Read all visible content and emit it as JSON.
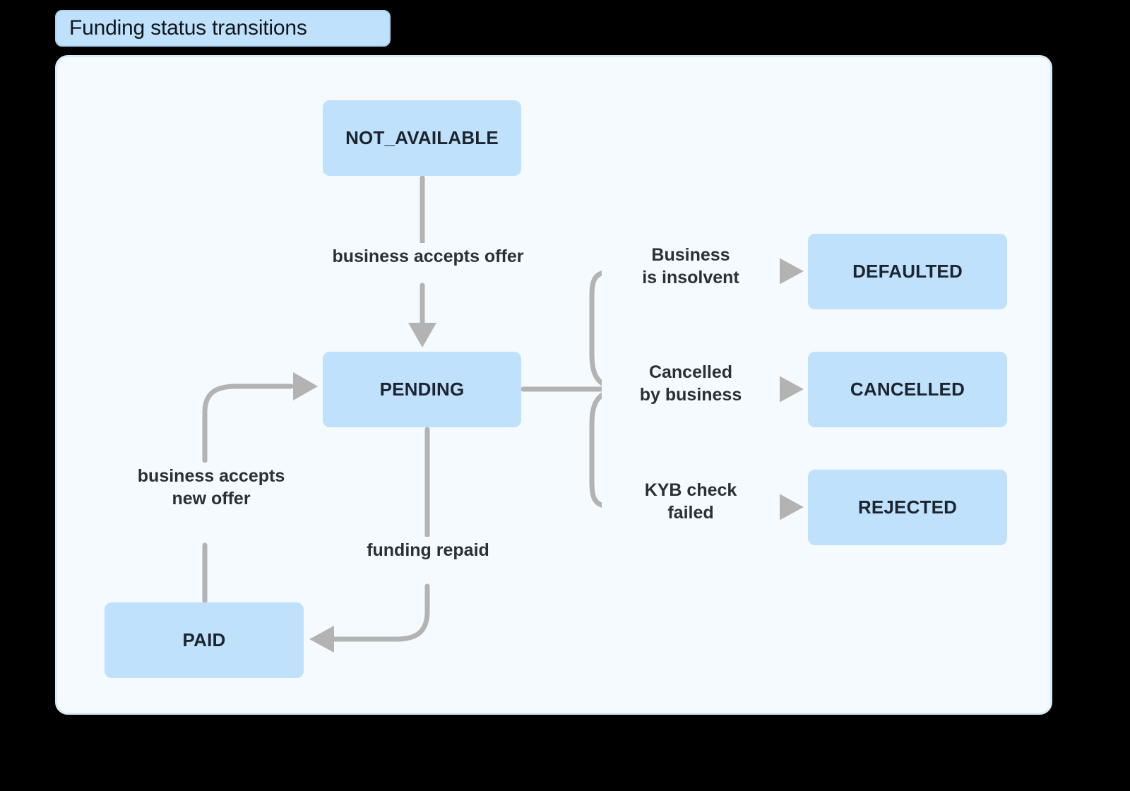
{
  "title": {
    "text": "Funding status transitions"
  },
  "colors": {
    "page_background": "#000000",
    "frame_background": "#f4fafe",
    "frame_border": "#d7ecfb",
    "node_fill": "#bfe1fb",
    "node_text": "#1c2430",
    "edge_stroke": "#b3b3b3",
    "edge_label_text": "#2b2f36",
    "title_fill": "#bfe1fb",
    "title_border": "#a9d4f2"
  },
  "chart_data": {
    "type": "diagram",
    "diagram_kind": "state-transition-flowchart",
    "title": "Funding status transitions",
    "nodes": [
      {
        "id": "not_available",
        "label": "NOT_AVAILABLE"
      },
      {
        "id": "pending",
        "label": "PENDING"
      },
      {
        "id": "paid",
        "label": "PAID"
      },
      {
        "id": "defaulted",
        "label": "DEFAULTED"
      },
      {
        "id": "cancelled",
        "label": "CANCELLED"
      },
      {
        "id": "rejected",
        "label": "REJECTED"
      }
    ],
    "edges": [
      {
        "from": "not_available",
        "to": "pending",
        "label": "business accepts offer"
      },
      {
        "from": "pending",
        "to": "defaulted",
        "label": "Business\nis insolvent"
      },
      {
        "from": "pending",
        "to": "cancelled",
        "label": "Cancelled\nby business"
      },
      {
        "from": "pending",
        "to": "rejected",
        "label": "KYB check\nfailed"
      },
      {
        "from": "pending",
        "to": "paid",
        "label": "funding repaid"
      },
      {
        "from": "paid",
        "to": "pending",
        "label": "business accepts\nnew offer"
      }
    ]
  },
  "nodes": {
    "not_available": "NOT_AVAILABLE",
    "pending": "PENDING",
    "paid": "PAID",
    "defaulted": "DEFAULTED",
    "cancelled": "CANCELLED",
    "rejected": "REJECTED"
  },
  "edge_labels": {
    "accepts_offer": "business accepts offer",
    "funding_repaid": "funding repaid",
    "accepts_new_offer": "business accepts\nnew offer",
    "business_insolvent": "Business\nis insolvent",
    "cancelled_by_business": "Cancelled\nby business",
    "kyb_check_failed": "KYB check\nfailed"
  }
}
